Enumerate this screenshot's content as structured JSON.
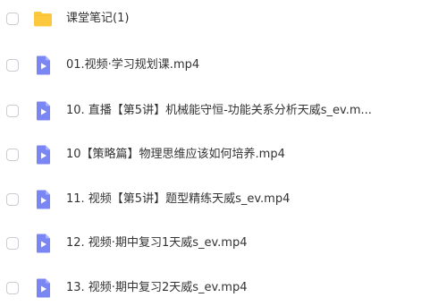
{
  "files": [
    {
      "name": "课堂笔记(1)",
      "type": "folder"
    },
    {
      "name": "01.视频·学习规划课.mp4",
      "type": "video"
    },
    {
      "name": "10. 直播【第5讲】机械能守恒-功能关系分析天威s_ev.m...",
      "type": "video"
    },
    {
      "name": "10【策略篇】物理思维应该如何培养.mp4",
      "type": "video"
    },
    {
      "name": "11. 视频【第5讲】题型精练天威s_ev.mp4",
      "type": "video"
    },
    {
      "name": "12. 视频·期中复习1天威s_ev.mp4",
      "type": "video"
    },
    {
      "name": "13. 视频·期中复习2天威s_ev.mp4",
      "type": "video"
    }
  ],
  "colors": {
    "folder": "#fcc93e",
    "video": "#7b86f5",
    "text": "#333333"
  }
}
